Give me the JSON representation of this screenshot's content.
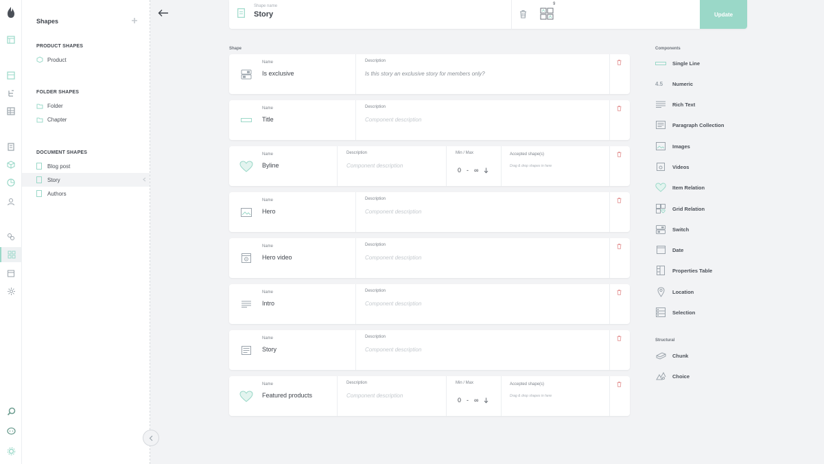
{
  "colors": {
    "accent": "#9ad8c8",
    "delete": "#e8a3a3",
    "icon": "#9aa3ab",
    "text": "#3f444c"
  },
  "rail": {
    "icons": [
      "crystallize-logo-icon",
      "catalogue-icon",
      "grid-icon",
      "tree-icon",
      "list-icon",
      "document-icon",
      "box-icon",
      "pie-chart-icon",
      "user-icon",
      "link-icon",
      "shapes-icon",
      "calendar-icon",
      "settings-icon",
      "search-icon",
      "chat-icon",
      "gear-icon"
    ]
  },
  "panel": {
    "title": "Shapes",
    "sections": [
      {
        "title": "PRODUCT SHAPES",
        "items": [
          "Product"
        ]
      },
      {
        "title": "FOLDER SHAPES",
        "items": [
          "Folder",
          "Chapter"
        ]
      },
      {
        "title": "DOCUMENT SHAPES",
        "items": [
          "Blog post",
          "Story",
          "Authors"
        ]
      }
    ],
    "selected": "Story"
  },
  "header": {
    "name_label": "Shape name",
    "name_value": "Story",
    "shape_count": "9",
    "update_label": "Update"
  },
  "list_label": "Shape",
  "labels": {
    "name": "Name",
    "description": "Description",
    "min_max": "Min / Max",
    "accepted": "Accepted shape(s)",
    "drop_hint": "Drag & drop shapes in here",
    "desc_placeholder": "Component description"
  },
  "components": [
    {
      "type": "switch",
      "icon": "switch-icon",
      "name": "Is exclusive",
      "description": "Is this story an exclusive story for members only?"
    },
    {
      "type": "single-line",
      "icon": "single-line-icon",
      "name": "Title",
      "description": ""
    },
    {
      "type": "item-relation",
      "icon": "heart-icon",
      "name": "Byline",
      "description": "",
      "min": "0",
      "max": "∞"
    },
    {
      "type": "images",
      "icon": "image-icon",
      "name": "Hero",
      "description": ""
    },
    {
      "type": "videos",
      "icon": "video-icon",
      "name": "Hero video",
      "description": ""
    },
    {
      "type": "rich-text",
      "icon": "rich-text-icon",
      "name": "Intro",
      "description": ""
    },
    {
      "type": "paragraph-collection",
      "icon": "paragraph-icon",
      "name": "Story",
      "description": ""
    },
    {
      "type": "item-relation",
      "icon": "heart-icon",
      "name": "Featured products",
      "description": "",
      "min": "0",
      "max": "∞"
    }
  ],
  "palette": {
    "components_title": "Components",
    "components": [
      {
        "label": "Single Line",
        "icon": "single-line-icon"
      },
      {
        "label": "Numeric",
        "icon": "numeric-icon"
      },
      {
        "label": "Rich Text",
        "icon": "rich-text-icon"
      },
      {
        "label": "Paragraph Collection",
        "icon": "paragraph-icon"
      },
      {
        "label": "Images",
        "icon": "image-icon"
      },
      {
        "label": "Videos",
        "icon": "video-icon"
      },
      {
        "label": "Item Relation",
        "icon": "heart-icon"
      },
      {
        "label": "Grid Relation",
        "icon": "grid-relation-icon"
      },
      {
        "label": "Switch",
        "icon": "switch-icon"
      },
      {
        "label": "Date",
        "icon": "date-icon"
      },
      {
        "label": "Properties Table",
        "icon": "properties-table-icon"
      },
      {
        "label": "Location",
        "icon": "location-icon"
      },
      {
        "label": "Selection",
        "icon": "selection-icon"
      }
    ],
    "structural_title": "Structural",
    "structural": [
      {
        "label": "Chunk",
        "icon": "chunk-icon"
      },
      {
        "label": "Choice",
        "icon": "choice-icon"
      }
    ]
  }
}
